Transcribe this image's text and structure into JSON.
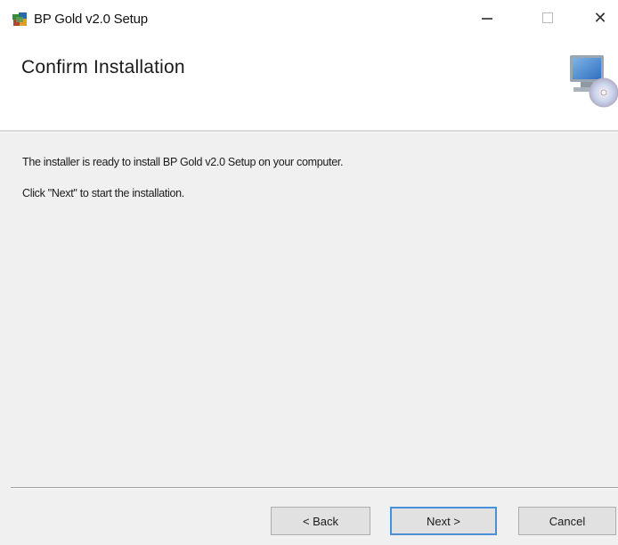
{
  "window": {
    "title": "BP Gold v2.0 Setup"
  },
  "header": {
    "title": "Confirm Installation"
  },
  "content": {
    "line1": "The installer is ready to install BP Gold v2.0 Setup on your computer.",
    "line2": "Click \"Next\" to start the installation."
  },
  "buttons": {
    "back": "< Back",
    "next": "Next >",
    "cancel": "Cancel"
  },
  "titlebar_controls": {
    "close_glyph": "✕"
  },
  "colors": {
    "accent_border": "#4a90d9",
    "panel_bg": "#f0f0f0"
  }
}
